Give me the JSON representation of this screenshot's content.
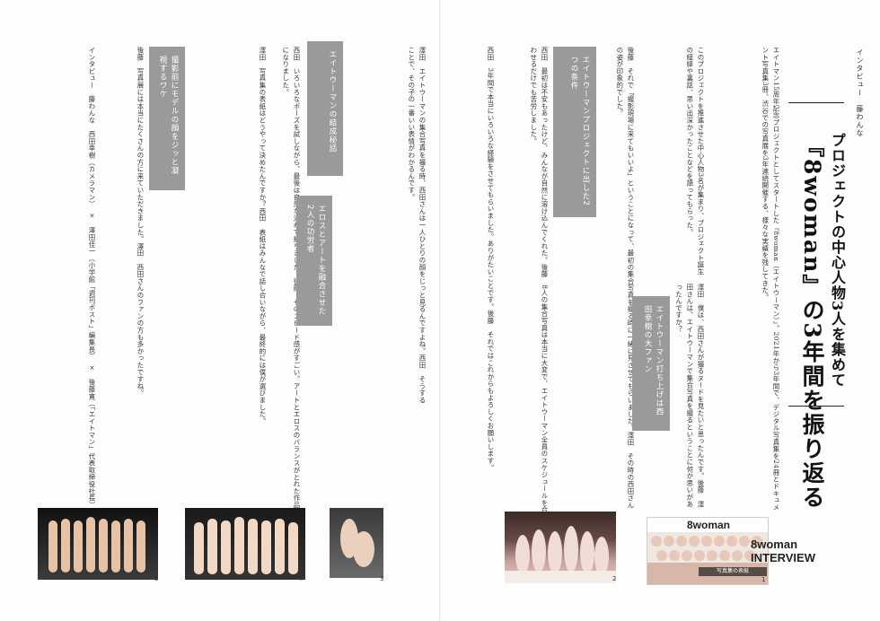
{
  "header": {
    "label": "インタビュー　藤わんな",
    "subtitle": "プロジェクトの中心人物3人を集めて",
    "title": "『8woman』の3年間を振り返る"
  },
  "boxes": {
    "b1": "エイトウーマンプロジェクトに出した2つの条件",
    "b2": "エイトウーマンの結成秘話",
    "b3": "撮影前にモデルの顔をジッと凝視するワケ",
    "b4": "エロスとアートを融合させた2人の功労者",
    "b5": "エイトウーマン打ち上げは西田幸樹の大ファン"
  },
  "columns": {
    "r1": "インタビュー　藤わんな　西田幸樹（カメラマン）　×　澤田佳一（小学館「週刊ポスト」編集長）　×　後藤寛（「エイトマン」代表取締役社長）",
    "r2": "エイトマン15周年記念プロジェクトとしてスタートした『8woman（エイトウーマン）』。2021年から3年間で、デジタル写真集を24冊とドキュメント写真集3冊、渋谷での写真展を3年連続開催する、様々な実績を残してきた。",
    "r3": "このプロジェクトを推進させた中心人物3名が集まり、プロジェクト誕生の経緯や裏話、思い出深かったことなどを語ってもらった。",
    "r4": "澤田　僕は、西田さんが撮るヌードを見たいと思ったんです。後藤　澤田さんは、エイトウーマンで集合写真を撮るということに何か思いがあったんですか？",
    "r5": "後藤　それで「撮影現場に来てもいいよ」ということになって、最初の集合写真を撮る時に一緒に見させてもらいました。澤田　その時の西田さんの姿が印象的でした。",
    "r6": "西田　最初は不安もあったけど、みんなが自然に溶け込んでくれた。後藤　8人の集合写真は本当に大変で、エイトウーマン全員のスケジュールを合わせるだけでも苦労しました。",
    "r7": "澤田　エイトウーマンの集合写真を撮る時、西田さんは一人ひとりの顔をじっと見るんですよね。西田　そうすることで、その子の一番いい表情がわかるんです。",
    "r8": "西田　いろいろなポーズを試しながら、最後は自然な流れで撮りました。後藤　そのスピード感がすごい。アートとエロスのバランスがとれた作品になりました。",
    "r9": "澤田　写真集の表紙はどうやって決めたんですか？西田　表紙はみんなで話し合いながら、最終的には僕が選びました。",
    "r10": "後藤　写真展には本当にたくさんの方に来ていただきました。澤田　西田さんのファンの方も多かったですね。",
    "r11": "西田　3年間で本当にいろいろな経験をさせてもらいました。ありがたいことです。後藤　それではこれからもよろしくお願いします。"
  },
  "photos": {
    "p1": "1",
    "p2": "2",
    "p3": "3",
    "p4": "4",
    "p5": "5",
    "cover_title": "8woman",
    "cover_caption": "写真集の表紙"
  },
  "brand": {
    "line1": "8woman",
    "line2": "INTERVIEW"
  }
}
